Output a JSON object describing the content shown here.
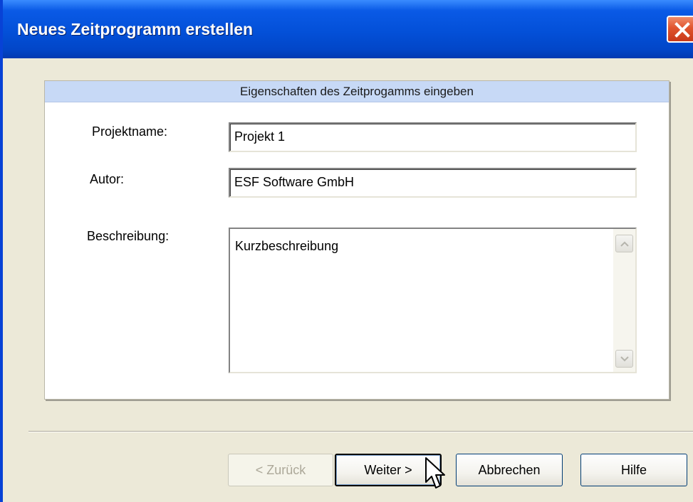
{
  "window": {
    "title": "Neues Zeitprogramm erstellen"
  },
  "panel": {
    "header": "Eigenschaften des Zeitprogamms eingeben"
  },
  "form": {
    "projektname_label": "Projektname:",
    "projektname_value": "Projekt 1",
    "autor_label": "Autor:",
    "autor_value": "ESF Software GmbH",
    "beschreibung_label": "Beschreibung:",
    "beschreibung_value": "Kurzbeschreibung"
  },
  "buttons": {
    "back": "< Zurück",
    "next": "Weiter >",
    "cancel": "Abbrechen",
    "help": "Hilfe"
  },
  "colors": {
    "titlebar": "#0350d8",
    "panel_header": "#c7d9f6",
    "dialog_bg": "#ece9d8"
  }
}
